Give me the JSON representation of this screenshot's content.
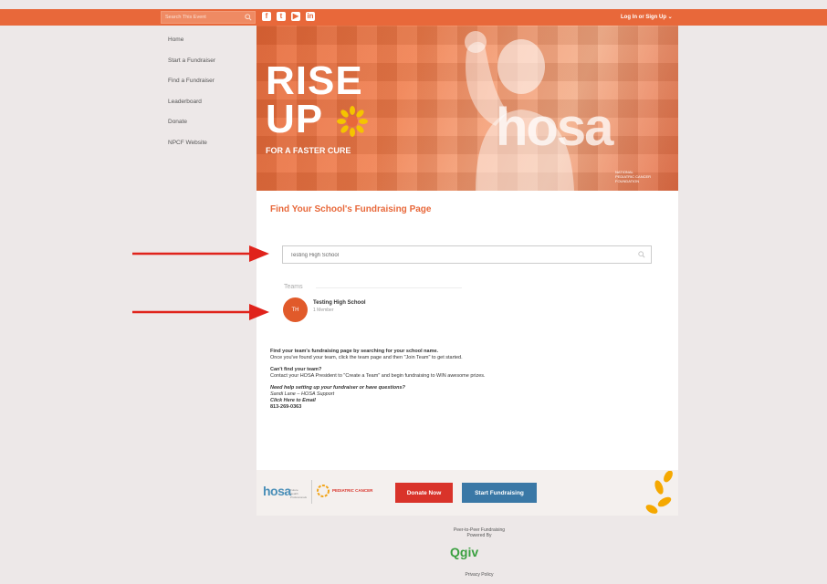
{
  "topbar": {
    "search_placeholder": "Search This Event",
    "socials": [
      {
        "icon": "facebook-icon",
        "glyph": "f"
      },
      {
        "icon": "twitter-icon",
        "glyph": "t"
      },
      {
        "icon": "youtube-icon",
        "glyph": "▶"
      },
      {
        "icon": "linkedin-icon",
        "glyph": "in"
      }
    ],
    "login_label": "Log In or Sign Up ⌄"
  },
  "leftnav": {
    "items": [
      "Home",
      "Start a Fundraiser",
      "Find a Fundraiser",
      "Leaderboard",
      "Donate",
      "NPCF Website"
    ]
  },
  "hero": {
    "line1": "RISE",
    "line2": "UP",
    "tagline": "FOR A FASTER CURE",
    "brand": "hosa",
    "npcf_line1": "NATIONAL",
    "npcf_line2": "PEDIATRIC CANCER",
    "npcf_line3": "FOUNDATION"
  },
  "main": {
    "title": "Find Your School's Fundraising Page",
    "search_value": "Testing High School",
    "teams_label": "Teams",
    "team": {
      "initials": "TH",
      "name": "Testing High School",
      "members": "1 Member"
    },
    "info": {
      "heading1": "Find your team's fundraising page by searching for your school name.",
      "text1": "Once you've found your team, click the team page and then \"Join Team\" to get started.",
      "heading2": "Can't find your team?",
      "text2": "Contact your HOSA President to \"Create a Team\" and begin fundraising to WIN awesome prizes.",
      "heading3": "Need help setting up your fundraiser or have questions?",
      "contact_name": "Sandi Lane – HOSA Support",
      "email_link": "Click Here to Email",
      "phone": "813-269-0363"
    }
  },
  "footer": {
    "hosa_text": "hosa",
    "hosa_sub": "Future Health Professionals",
    "npcf_text": "PEDIATRIC CANCER",
    "donate_label": "Donate Now",
    "start_label": "Start Fundraising",
    "p2p_line1": "Peer-to-Peer Fundraising",
    "p2p_line2": "Powered By",
    "qgiv": "Qgiv",
    "privacy": "Privacy Policy"
  },
  "colors": {
    "brand_orange": "#e8683a",
    "donate_red": "#d9332a",
    "start_blue": "#3a78a6",
    "annotation_red": "#e0231b"
  }
}
